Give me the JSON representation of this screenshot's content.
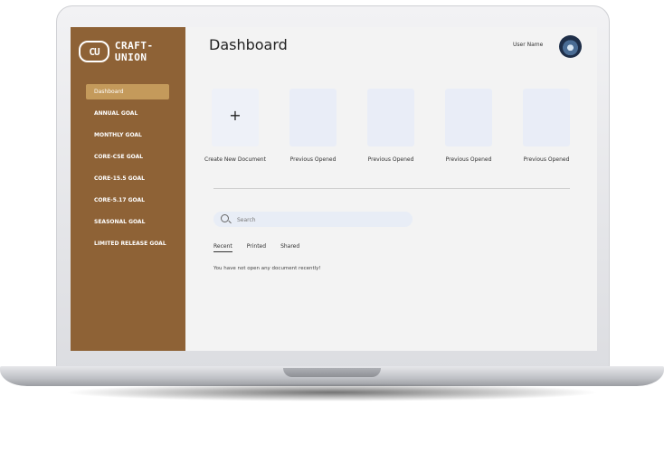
{
  "app": {
    "logo_mark": "CU",
    "brand_name": "CRAFT-UNION",
    "colors": {
      "sidebar": "#8e6236",
      "active_nav": "#c49a5b",
      "card": "#e9edf7"
    }
  },
  "sidebar": {
    "items": [
      {
        "label": "Dashboard",
        "active": true
      },
      {
        "label": "ANNUAL GOAL"
      },
      {
        "label": "MONTHLY GOAL"
      },
      {
        "label": "CORE-CSE GOAL"
      },
      {
        "label": "CORE-15.5 GOAL"
      },
      {
        "label": "CORE-5.17 GOAL"
      },
      {
        "label": "SEASONAL GOAL"
      },
      {
        "label": "LIMITED RELEASE GOAL"
      }
    ]
  },
  "header": {
    "title": "Dashboard",
    "user_name": "User Name"
  },
  "documents": {
    "create_icon": "plus-icon",
    "create_symbol": "+",
    "create_label": "Create New Document",
    "previous_label": "Previous Opened"
  },
  "search": {
    "placeholder": "Search",
    "icon": "search-icon"
  },
  "tabs": [
    "Recent",
    "Printed",
    "Shared"
  ],
  "empty_message": "You have not open any document recently!"
}
